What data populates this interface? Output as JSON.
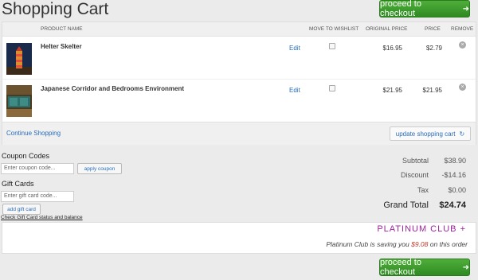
{
  "page": {
    "title": "Shopping Cart"
  },
  "checkout": {
    "label": "proceed to checkout",
    "arrow": "➜"
  },
  "columns": {
    "product_name": "PRODUCT NAME",
    "move_to_wishlist": "MOVE TO WISHLIST",
    "original_price": "ORIGINAL PRICE",
    "price": "PRICE",
    "remove": "REMOVE"
  },
  "items": [
    {
      "name": "Helter Skelter",
      "edit": "Edit",
      "original_price": "$16.95",
      "price": "$2.79",
      "remove_icon": "×"
    },
    {
      "name": "Japanese Corridor and Bedrooms Environment",
      "edit": "Edit",
      "original_price": "$21.95",
      "price": "$21.95",
      "remove_icon": "×"
    }
  ],
  "cart_footer": {
    "continue": "Continue Shopping",
    "update": "update shopping cart",
    "update_icon": "↻"
  },
  "coupon": {
    "heading": "Coupon Codes",
    "placeholder": "Enter coupon code...",
    "button": "apply coupon"
  },
  "gift": {
    "heading": "Gift Cards",
    "placeholder": "Enter gift card code...",
    "button": "add gift card",
    "link": "Check Gift Card status and balance"
  },
  "totals": {
    "subtotal_label": "Subtotal",
    "subtotal": "$38.90",
    "discount_label": "Discount",
    "discount": "-$14.16",
    "tax_label": "Tax",
    "tax": "$0.00",
    "grand_label": "Grand Total",
    "grand": "$24.74"
  },
  "platinum": {
    "logo": "PLATINUM CLUB +",
    "save_prefix": "Platinum Club is saving you ",
    "save_amount": "$9.08",
    "save_suffix": " on this order"
  },
  "colors": {
    "checkout_green": "#3a9a2c",
    "link_blue": "#2a6ebb",
    "platinum_purple": "#a020a0",
    "savings_red": "#c0392b"
  }
}
